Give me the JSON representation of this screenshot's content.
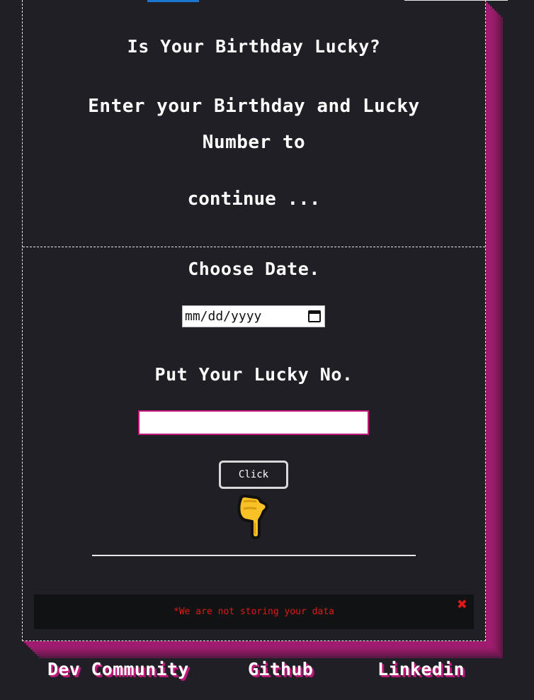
{
  "header": {
    "title": "Is Your Birthday Lucky?",
    "subtitle": "Enter your Birthday and Lucky Number to",
    "continue_text": "continue ..."
  },
  "form": {
    "date_label": "Choose Date.",
    "date_placeholder": "mm/dd/yyyy",
    "lucky_label": "Put Your Lucky No.",
    "lucky_value": "",
    "button_label": "Click",
    "pointer_icon": "pointing-down-hand-icon"
  },
  "notice": {
    "text": "*We are not storing your data",
    "close_icon": "close-icon",
    "close_glyph": "✖",
    "color": "#e01818"
  },
  "footer": {
    "links": [
      {
        "label": "Dev Community"
      },
      {
        "label": "Github"
      },
      {
        "label": "Linkedin"
      }
    ]
  },
  "colors": {
    "background": "#1f1f25",
    "accent_pink": "#c2187a",
    "top_accent_blue": "#1a77d4"
  }
}
